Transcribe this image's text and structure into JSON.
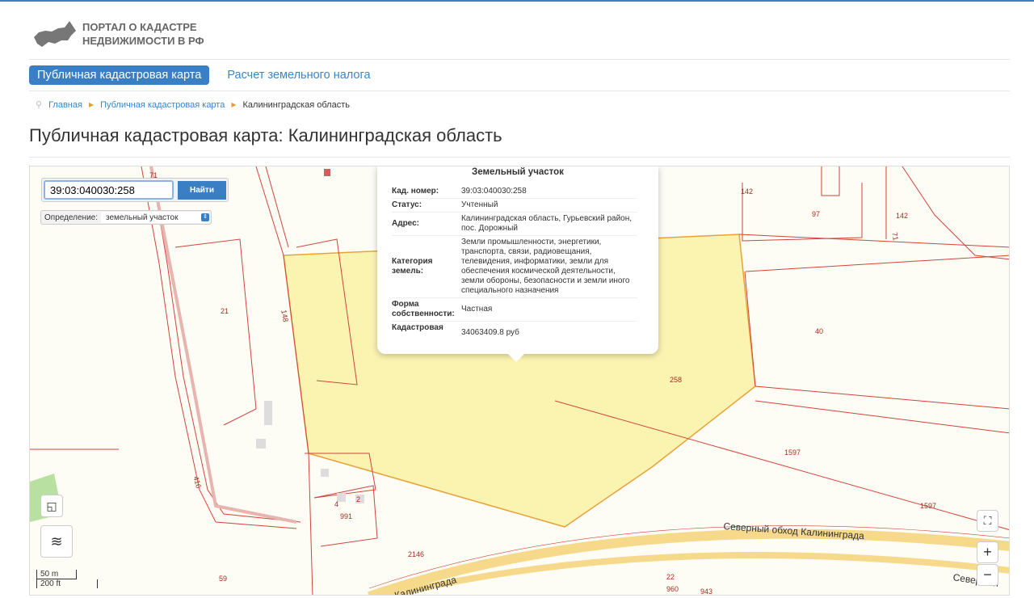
{
  "header": {
    "logo_line1": "ПОРТАЛ О КАДАСТРЕ",
    "logo_line2": "НЕДВИЖИМОСТИ В РФ"
  },
  "nav": {
    "tabs": [
      {
        "label": "Публичная кадастровая карта",
        "active": true
      },
      {
        "label": "Расчет земельного налога",
        "active": false
      }
    ]
  },
  "breadcrumb": [
    "Главная",
    "Публичная кадастровая карта",
    "Калининградская область"
  ],
  "page_title": "Публичная кадастровая карта: Калининградская область",
  "search": {
    "value": "39:03:040030:258",
    "button": "Найти",
    "definition_label": "Определение:",
    "definition_value": "земельный участок"
  },
  "popup": {
    "title": "Земельный участок",
    "rows": [
      {
        "key": "Кад. номер:",
        "value": "39:03:040030:258"
      },
      {
        "key": "Статус:",
        "value": "Учтенный"
      },
      {
        "key": "Адрес:",
        "value": "Калининградская область, Гурьевский район, пос. Дорожный"
      },
      {
        "key": "Категория земель:",
        "value": "Земли промышленности, энергетики, транспорта, связи, радиовещания, телевидения, информатики, земли для обеспечения космической деятельности, земли обороны, безопасности и земли иного специального назначения"
      },
      {
        "key": "Форма собственности:",
        "value": "Частная"
      },
      {
        "key": "Кадастровая",
        "value": "34063409.8 руб"
      }
    ]
  },
  "map_labels": {
    "a": "142",
    "b": "97",
    "c": "142",
    "d": "21",
    "e": "148",
    "f": "40",
    "g": "258",
    "h": "1597",
    "i": "1597",
    "j": "416",
    "k": "991",
    "l": "4",
    "m": "2",
    "n": "2146",
    "o": "59",
    "p": "22",
    "q": "960",
    "r": "943",
    "s": "71",
    "t": "71"
  },
  "roads": {
    "main": "Северный обход Калининграда",
    "left": "Калининграда",
    "right": "Северный"
  },
  "controls": {
    "zoom_in": "+",
    "zoom_out": "−"
  },
  "scale": {
    "metric": "50 m",
    "imperial": "200 ft"
  },
  "colors": {
    "accent": "#3a7fc4",
    "parcel_fill": "#fbf3b0",
    "parcel_line": "#e8a23a",
    "boundary": "#d0453a"
  }
}
